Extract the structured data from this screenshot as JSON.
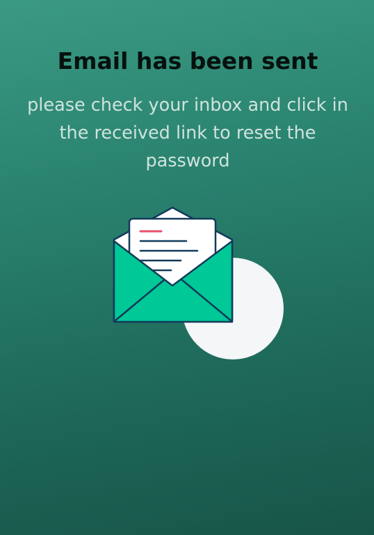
{
  "confirmation": {
    "title": "Email has been sent",
    "message": "please check your inbox and click in the received link to reset the password"
  },
  "illustration": {
    "icon": "open-envelope-with-letter",
    "colors": {
      "envelope_fill": "#00c896",
      "outline": "#123a5a",
      "letter": "#ffffff",
      "letter_accent": "#e8506a",
      "backdrop_circle": "#f4f6f8"
    }
  }
}
